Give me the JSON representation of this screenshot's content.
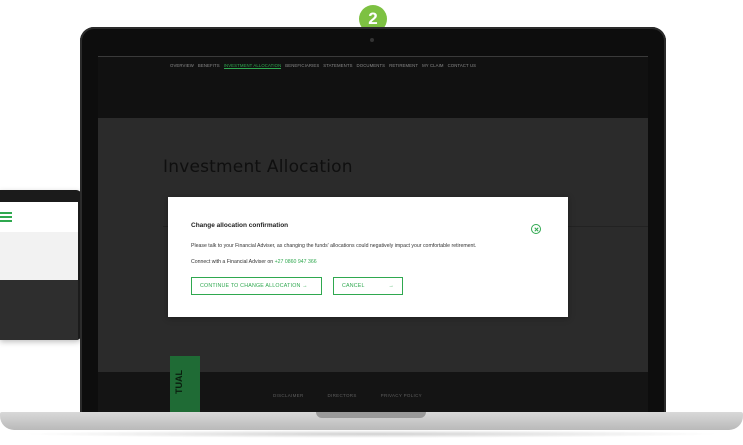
{
  "step": {
    "number": "2"
  },
  "nav": {
    "items": [
      {
        "label": "OVERVIEW",
        "active": false
      },
      {
        "label": "BENEFITS",
        "active": false
      },
      {
        "label": "INVESTMENT ALLOCATION",
        "active": true
      },
      {
        "label": "BENEFICIARIES",
        "active": false
      },
      {
        "label": "STATEMENTS",
        "active": false
      },
      {
        "label": "DOCUMENTS",
        "active": false
      },
      {
        "label": "RETIREMENT",
        "active": false
      },
      {
        "label": "MY CLAIM",
        "active": false
      },
      {
        "label": "CONTACT US",
        "active": false
      }
    ]
  },
  "page": {
    "title": "Investment Allocation"
  },
  "modal": {
    "title": "Change allocation confirmation",
    "body": "Please talk to your Financial Adviser, as changing the funds' allocations could negatively impact your comfortable retirement.",
    "contact_prefix": "Connect with a Financial Adviser on",
    "phone": "+27 0860 947 366",
    "continue_label": "CONTINUE TO CHANGE ALLOCATION →",
    "cancel_label": "CANCEL",
    "cancel_arrow": "→"
  },
  "footer": {
    "logo_text": "TUAL",
    "links": [
      "DISCLAIMER",
      "DIRECTORS",
      "PRIVACY POLICY"
    ]
  },
  "colors": {
    "accent": "#2fa84f",
    "badge": "#7dc142"
  }
}
